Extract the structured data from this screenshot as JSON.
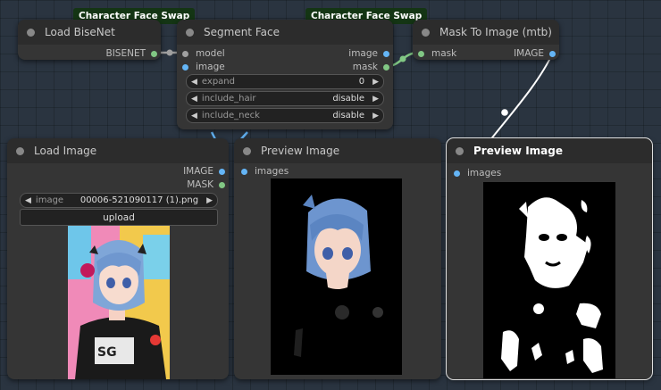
{
  "badges": {
    "bisenet_badge": "Character Face Swap",
    "segment_badge": "Character Face Swap"
  },
  "load_bisenet": {
    "title": "Load BiseNet",
    "output": "BISENET"
  },
  "segment_face": {
    "title": "Segment Face",
    "inputs": [
      "model",
      "image"
    ],
    "outputs": [
      "image",
      "mask"
    ],
    "widgets": [
      {
        "label": "expand",
        "value": "0"
      },
      {
        "label": "include_hair",
        "value": "disable"
      },
      {
        "label": "include_neck",
        "value": "disable"
      }
    ]
  },
  "mask_to_image": {
    "title": "Mask To Image (mtb)",
    "input": "mask",
    "output": "IMAGE"
  },
  "load_image": {
    "title": "Load Image",
    "outputs": [
      "IMAGE",
      "MASK"
    ],
    "widget_label": "image",
    "widget_value": "00006-521090117 (1).png",
    "upload_label": "upload"
  },
  "preview_image_1": {
    "title": "Preview Image",
    "input": "images"
  },
  "preview_image_2": {
    "title": "Preview Image",
    "input": "images"
  },
  "colors": {
    "image_slot": "#64b5f6",
    "mask_slot": "#81c784",
    "model_slot": "#a0a0a0",
    "badge_bg": "#143514",
    "canvas_bg": "#2a3440",
    "node_bg": "#353535"
  }
}
